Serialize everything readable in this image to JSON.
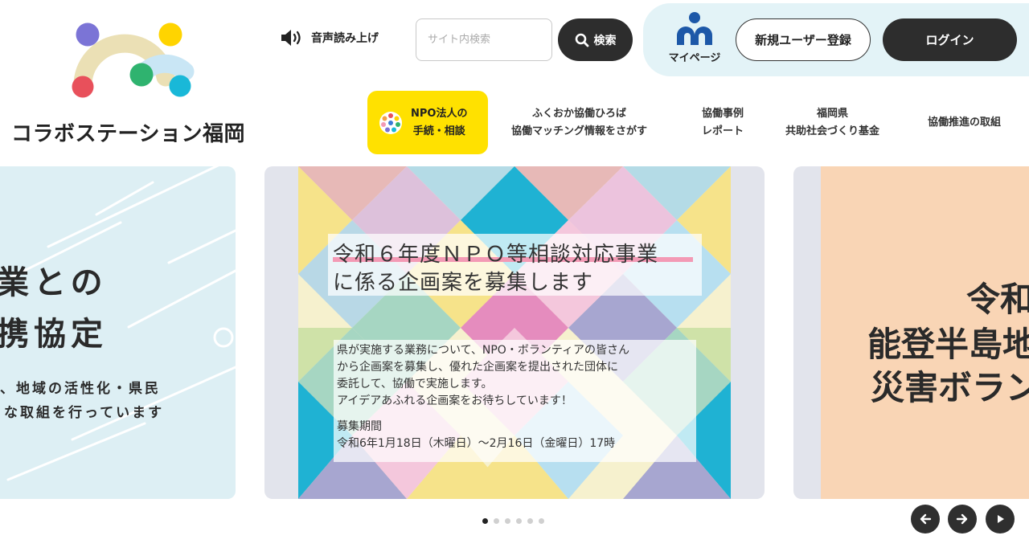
{
  "header": {
    "site_title": "コラボステーション福岡",
    "tts_label": "音声読み上げ",
    "search": {
      "placeholder": "サイト内検索",
      "button_label": "検索"
    },
    "mypage_label": "マイページ",
    "register_label": "新規ユーザー登録",
    "login_label": "ログイン"
  },
  "nav": {
    "npo": {
      "line1": "NPO法人の",
      "line2": "手続・相談"
    },
    "items": [
      {
        "line1": "ふくおか協働ひろば",
        "line2": "協働マッチング情報をさがす"
      },
      {
        "line1": "協働事例",
        "line2": "レポート"
      },
      {
        "line1": "福岡県",
        "line2": "共助社会づくり基金"
      },
      {
        "line1": "協働推進の取組",
        "line2": ""
      }
    ]
  },
  "slides": {
    "left": {
      "line1": "業との",
      "line2": "携協定",
      "line3": "、地域の活性化・県民",
      "line4": "な取組を行っています"
    },
    "center": {
      "title_line1": "令和６年度ＮＰＯ等相談対応事業",
      "title_line2": "に係る企画案を募集します",
      "body": [
        " 県が実施する業務について、NPO・ボランティアの皆さん",
        "から企画案を募集し、優れた企画案を提出された団体に",
        "委託して、協働で実施します。",
        " アイデアあふれる企画案をお待ちしています！"
      ],
      "period_label": "募集期間",
      "period_value": " 令和6年1月18日（木曜日）～2月16日（金曜日）17時"
    },
    "right": {
      "line1": "令和",
      "line2": "能登半島地",
      "line3": "災害ボラン"
    }
  },
  "slider": {
    "count": 6,
    "active_index": 0
  },
  "colors": {
    "accent_yellow": "#ffe100",
    "dark": "#2d2d2d",
    "panel_bg": "#e3f3f7",
    "logo_purple": "#7b74d6",
    "logo_yellow": "#ffd400",
    "logo_red": "#e8505b",
    "logo_green": "#2fb36f",
    "logo_cyan": "#19b8d8"
  },
  "icons": [
    "speaker-icon",
    "search-icon",
    "mypage-person-icon",
    "npo-color-wheel-icon",
    "arrow-left-icon",
    "arrow-right-icon",
    "play-icon"
  ]
}
